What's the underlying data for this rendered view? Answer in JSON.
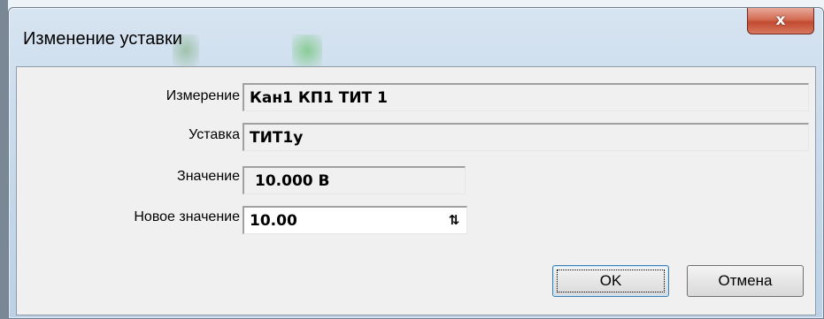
{
  "dialog": {
    "title": "Изменение уставки",
    "close_icon": "close-icon",
    "close_symbol": "x"
  },
  "form": {
    "measurement": {
      "label": "Измерение",
      "value": "Кан1 КП1 ТИТ 1"
    },
    "setpoint": {
      "label": "Уставка",
      "value": "ТИТ1у"
    },
    "current_value": {
      "label": "Значение",
      "value": "10.000 В"
    },
    "new_value": {
      "label": "Новое значение",
      "value": "10.00",
      "spin_icon": "spin-arrows-icon",
      "spin_symbol": "⇅"
    }
  },
  "buttons": {
    "ok": "OK",
    "cancel": "Отмена"
  },
  "colors": {
    "close_button": "#c14a2f",
    "title_bar": "#c9dbec",
    "client_bg": "#f0f0f0"
  }
}
